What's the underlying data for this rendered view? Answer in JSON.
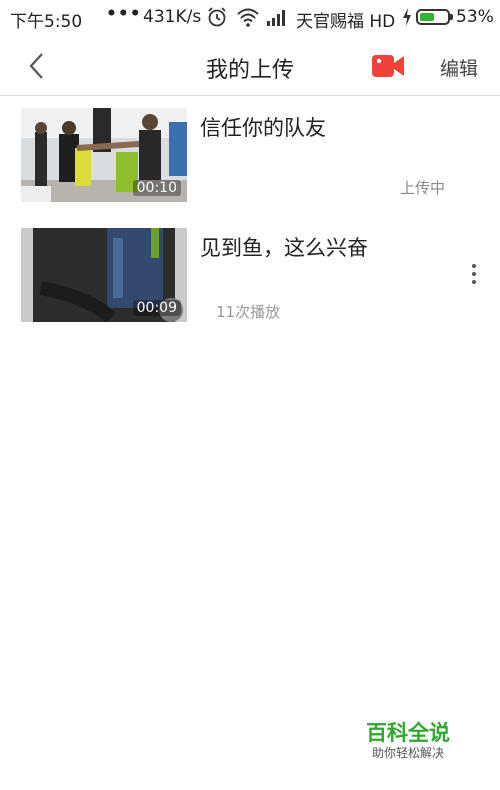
{
  "status_bar": {
    "time": "下午5:50",
    "dots": "•••",
    "net_speed": "431K/s",
    "carrier": "天官赐福 HD",
    "battery_percent": "53%",
    "battery_level": 0.53,
    "icons": [
      "alarm-icon",
      "wifi-icon",
      "signal-icon",
      "charging-bolt-icon",
      "battery-icon"
    ]
  },
  "header": {
    "title": "我的上传",
    "edit_label": "编辑",
    "back_icon": "chevron-left-icon",
    "video_icon": "video-camera-icon",
    "accent_color": "#f0413a"
  },
  "videos": [
    {
      "title": "信任你的队友",
      "duration": "00:10",
      "status": "上传中"
    },
    {
      "title": "见到鱼，这么兴奋",
      "duration": "00:09",
      "plays": "11次播放",
      "menu_icon": "more-vertical-icon"
    }
  ],
  "watermark": {
    "title": "百科全说",
    "subtitle": "助你轻松解决",
    "color": "#2fa82f"
  }
}
